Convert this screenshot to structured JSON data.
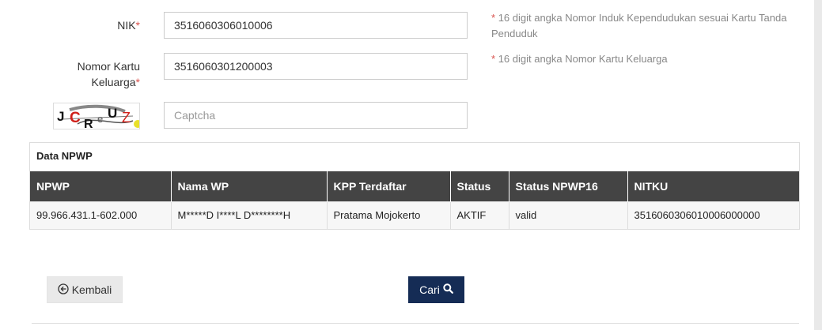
{
  "form": {
    "nik": {
      "label": "NIK",
      "required_mark": "*",
      "value": "3516060306010006",
      "help_star": "*",
      "help_text": "16 digit angka Nomor Induk Kependudukan sesuai Kartu Tanda Penduduk"
    },
    "kk": {
      "label_line1": "Nomor Kartu",
      "label_line2": "Keluarga",
      "required_mark": "*",
      "value": "3516060301200003",
      "help_star": "*",
      "help_text": "16 digit angka Nomor Kartu Keluarga"
    },
    "captcha": {
      "image_text": "JCReUZ",
      "placeholder": "Captcha",
      "value": ""
    }
  },
  "result_panel": {
    "heading": "Data NPWP",
    "columns": [
      "NPWP",
      "Nama WP",
      "KPP Terdaftar",
      "Status",
      "Status NPWP16",
      "NITKU"
    ],
    "rows": [
      [
        "99.966.431.1-602.000",
        "M*****D I****L D********H",
        "Pratama Mojokerto",
        "AKTIF",
        "valid",
        "3516060306010006000000"
      ]
    ]
  },
  "buttons": {
    "back_label": "Kembali",
    "search_label": "Cari"
  },
  "colors": {
    "primary_button": "#152c55",
    "table_header": "#444444",
    "required": "#d9534f"
  },
  "icons": {
    "back": "circle-arrow-left-icon",
    "search": "search-icon"
  }
}
